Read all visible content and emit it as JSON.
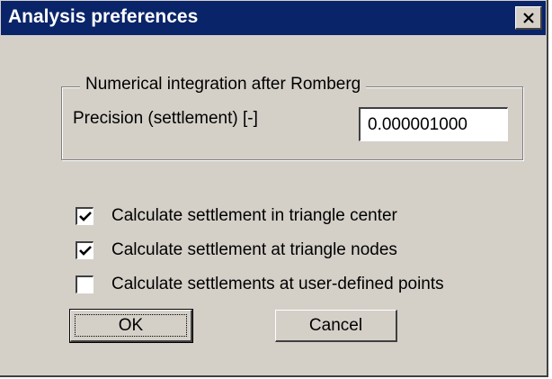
{
  "dialog": {
    "title": "Analysis preferences",
    "close_icon": "close-x-icon"
  },
  "integration": {
    "group_title": "Numerical integration after Romberg",
    "precision_label": "Precision (settlement) [-]",
    "precision_value": "0.000001000"
  },
  "options": [
    {
      "label": "Calculate settlement in triangle center",
      "checked": true
    },
    {
      "label": "Calculate settlement at triangle nodes",
      "checked": true
    },
    {
      "label": "Calculate settlements at user-defined points",
      "checked": false
    }
  ],
  "buttons": {
    "ok": "OK",
    "cancel": "Cancel"
  },
  "colors": {
    "titlebar": "#0a246a",
    "face": "#d4d0c8"
  }
}
